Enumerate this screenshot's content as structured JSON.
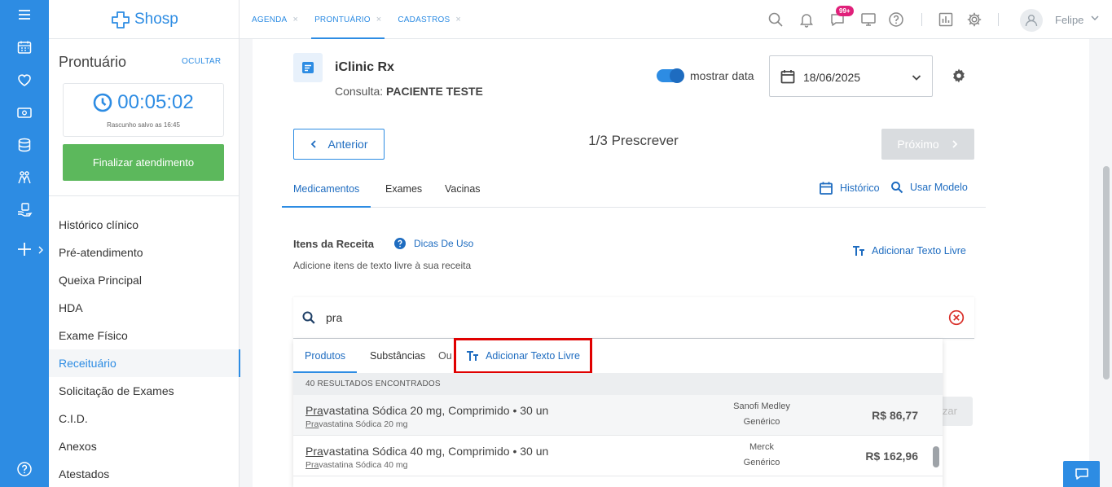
{
  "app": {
    "name": "Shosp"
  },
  "topbar": {
    "tabs": [
      {
        "label": "AGENDA",
        "active": false
      },
      {
        "label": "PRONTUÁRIO",
        "active": true
      },
      {
        "label": "CADASTROS",
        "active": false
      }
    ],
    "tab_close_glyph": "×",
    "notification_badge": "99+",
    "user_name": "Felipe"
  },
  "left_panel": {
    "title": "Prontuário",
    "hide_label": "OCULTAR",
    "timer": "00:05:02",
    "draft_saved": "Rascunho salvo as 16:45",
    "finish_button": "Finalizar atendimento",
    "menu": [
      {
        "label": "Histórico clínico",
        "active": false
      },
      {
        "label": "Pré-atendimento",
        "active": false
      },
      {
        "label": "Queixa Principal",
        "active": false
      },
      {
        "label": "HDA",
        "active": false
      },
      {
        "label": "Exame Físico",
        "active": false
      },
      {
        "label": "Receituário",
        "active": true
      },
      {
        "label": "Solicitação de Exames",
        "active": false
      },
      {
        "label": "C.I.D.",
        "active": false
      },
      {
        "label": "Anexos",
        "active": false
      },
      {
        "label": "Atestados",
        "active": false
      }
    ]
  },
  "main": {
    "title": "iClinic Rx",
    "consult_label": "Consulta:",
    "patient": "PACIENTE TESTE",
    "show_date_label": "mostrar data",
    "show_date_on": true,
    "date": "18/06/2025",
    "prev_button": "Anterior",
    "step_title": "1/3 Prescrever",
    "next_button": "Próximo",
    "tabs": [
      "Medicamentos",
      "Exames",
      "Vacinas"
    ],
    "history_link": "Histórico",
    "use_model_link": "Usar Modelo",
    "items_title": "Itens da Receita",
    "tips_link": "Dicas De Uso",
    "items_subtitle": "Adicione itens de texto livre à sua receita",
    "add_free_text": "Adicionar Texto Livre",
    "search_value": "pra",
    "behind_button_partial": "izar"
  },
  "dropdown": {
    "tabs": [
      "Produtos",
      "Substâncias"
    ],
    "or_label": "Ou",
    "add_free_text": "Adicionar Texto Livre",
    "results_count": "40 RESULTADOS ENCONTRADOS",
    "results": [
      {
        "match": "Pra",
        "name_rest": "vastatina Sódica 20 mg, Comprimido • 30 un",
        "sub_rest": "vastatina Sódica 20 mg",
        "maker": "Sanofi Medley",
        "type": "Genérico",
        "price": "R$ 86,77"
      },
      {
        "match": "Pra",
        "name_rest": "vastatina Sódica 40 mg, Comprimido • 30 un",
        "sub_rest": "vastatina Sódica 40 mg",
        "maker": "Merck",
        "type": "Genérico",
        "price": "R$ 162,96"
      }
    ]
  },
  "colors": {
    "brand": "#2d8ce3",
    "success": "#5cb85c",
    "highlight_box": "#e00000",
    "badge": "#e0207a"
  }
}
